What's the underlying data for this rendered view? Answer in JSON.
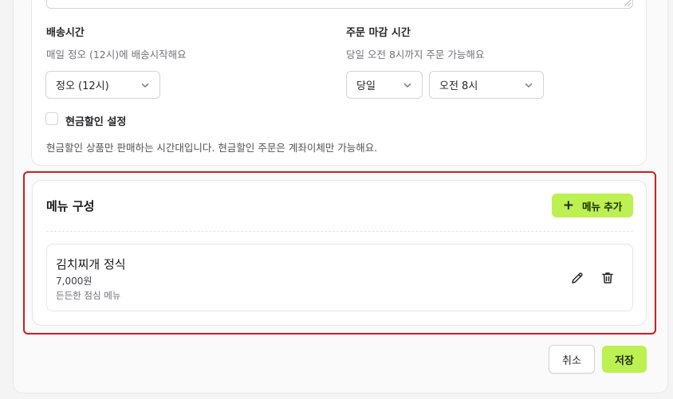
{
  "delivery": {
    "label": "배송시간",
    "hint": "매일 정오 (12시)에 배송시작해요",
    "time_select": "정오 (12시)"
  },
  "order_deadline": {
    "label": "주문 마감 시간",
    "hint": "당일 오전 8시까지 주문 가능해요",
    "day_select": "당일",
    "time_select": "오전 8시"
  },
  "cash_discount": {
    "label": "현금할인 설정",
    "checked": false,
    "description": "현금할인 상품만 판매하는 시간대입니다. 현금할인 주문은 계좌이체만 가능해요."
  },
  "menu": {
    "title": "메뉴 구성",
    "add_label": "메뉴 추가",
    "items": [
      {
        "name": "김치찌개 정식",
        "price": "7,000원",
        "description": "든든한 점심 메뉴"
      }
    ]
  },
  "actions": {
    "cancel_label": "취소",
    "save_label": "저장"
  },
  "colors": {
    "accent": "#bdf051",
    "highlight": "#d01c1f"
  },
  "icons": {
    "add": "plus-icon",
    "edit": "pencil-icon",
    "delete": "trash-icon",
    "dropdown": "chevron-down-icon"
  }
}
